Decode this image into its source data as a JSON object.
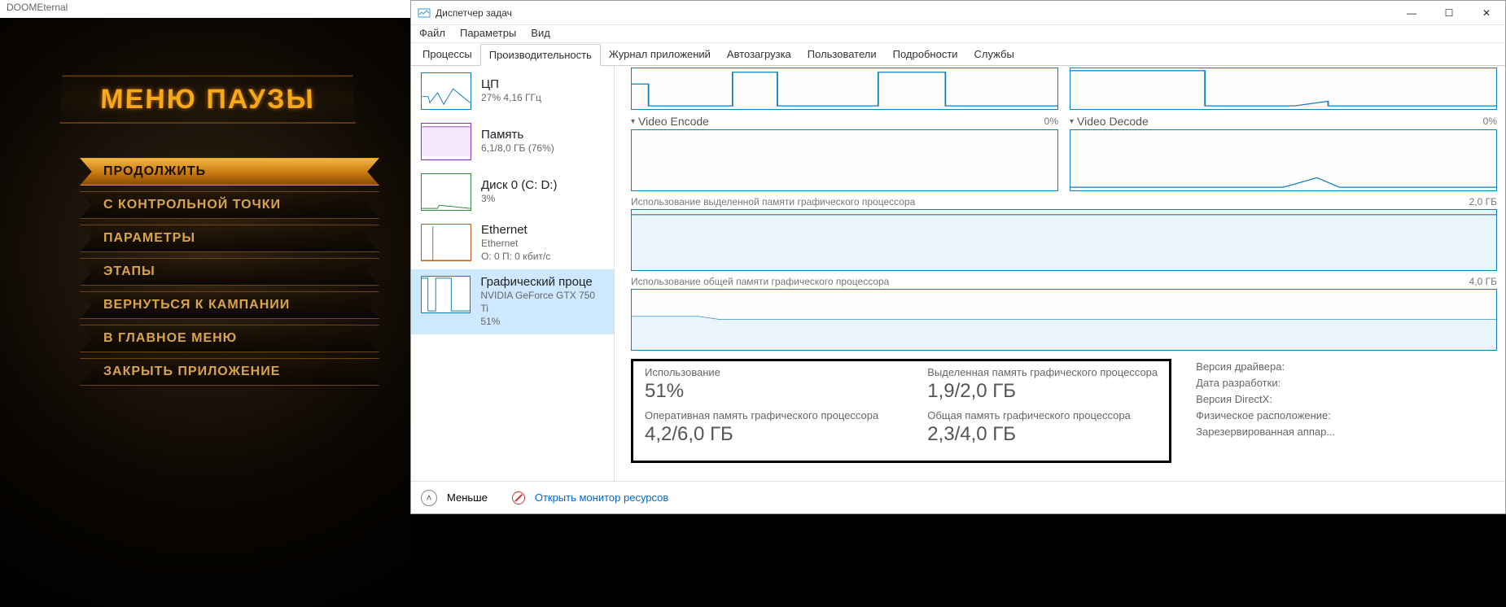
{
  "game": {
    "win_title": "DOOMEternal",
    "menu_title": "МЕНЮ ПАУЗЫ",
    "items": [
      {
        "label": "ПРОДОЛЖИТЬ",
        "sel": true
      },
      {
        "label": "С КОНТРОЛЬНОЙ ТОЧКИ"
      },
      {
        "label": "ПАРАМЕТРЫ"
      },
      {
        "label": "ЭТАПЫ"
      },
      {
        "label": "ВЕРНУТЬСЯ К КАМПАНИИ"
      },
      {
        "label": "В ГЛАВНОЕ МЕНЮ"
      },
      {
        "label": "ЗАКРЫТЬ ПРИЛОЖЕНИЕ"
      }
    ]
  },
  "tm": {
    "title": "Диспетчер задач",
    "menus": [
      "Файл",
      "Параметры",
      "Вид"
    ],
    "tabs": [
      "Процессы",
      "Производительность",
      "Журнал приложений",
      "Автозагрузка",
      "Пользователи",
      "Подробности",
      "Службы"
    ],
    "active_tab": 1,
    "side": [
      {
        "t1": "ЦП",
        "t2": "27% 4,16 ГГц",
        "color": "#117dbb"
      },
      {
        "t1": "Память",
        "t2": "6,1/8,0 ГБ (76%)",
        "color": "#8b2fb3"
      },
      {
        "t1": "Диск 0 (C: D:)",
        "t2": "3%",
        "color": "#2e8b3d"
      },
      {
        "t1": "Ethernet",
        "t2": "Ethernet",
        "t3": "О: 0  П: 0 кбит/с",
        "color": "#b35a1e"
      },
      {
        "t1": "Графический проце",
        "t2": "NVIDIA GeForce GTX 750 Ti",
        "t3": "51%",
        "color": "#117dbb",
        "sel": true
      }
    ],
    "top_charts": [
      {
        "title": "",
        "pct": ""
      },
      {
        "title": "",
        "pct": ""
      }
    ],
    "enc": {
      "title": "Video Encode",
      "pct": "0%"
    },
    "dec": {
      "title": "Video Decode",
      "pct": "0%"
    },
    "dedmem": {
      "title": "Использование выделенной памяти графического процессора",
      "max": "2,0 ГБ"
    },
    "sharedmem": {
      "title": "Использование общей памяти графического процессора",
      "max": "4,0 ГБ"
    },
    "stats": {
      "usage_lab": "Использование",
      "usage_val": "51%",
      "gpuram_lab": "Оперативная память графического процессора",
      "gpuram_val": "4,2/6,0 ГБ",
      "ded_lab": "Выделенная память графического процессора",
      "ded_val": "1,9/2,0 ГБ",
      "shared_lab": "Общая память графического процессора",
      "shared_val": "2,3/4,0 ГБ"
    },
    "meta": [
      "Версия драйвера:",
      "Дата разработки:",
      "Версия DirectX:",
      "Физическое расположение:",
      "Зарезервированная аппар..."
    ],
    "foot": {
      "less": "Меньше",
      "link": "Открыть монитор ресурсов"
    }
  }
}
